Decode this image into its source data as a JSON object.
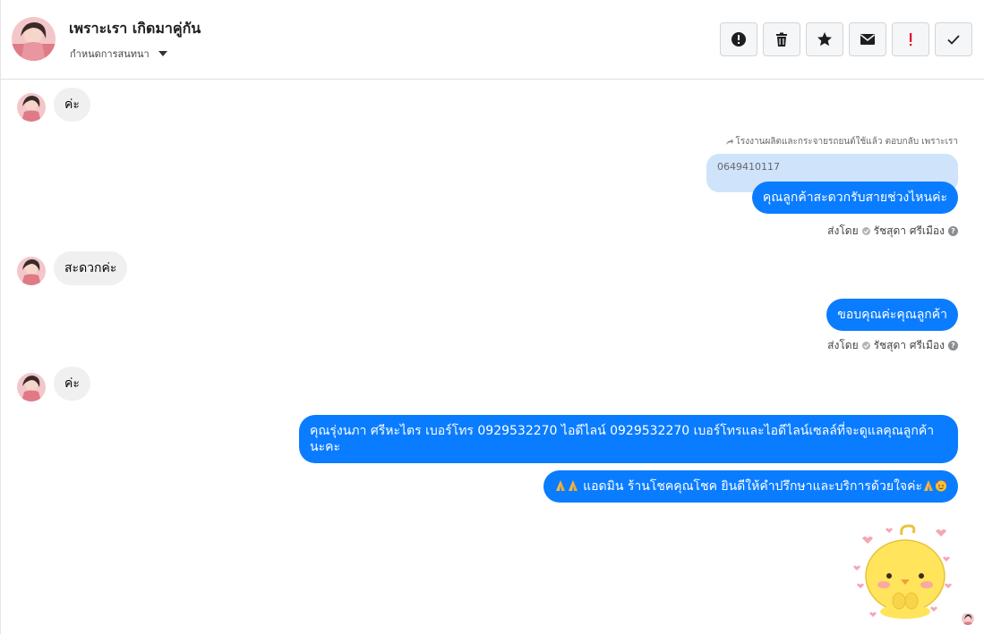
{
  "header": {
    "contact_name": "เพราะเรา เกิดมาคู่กัน",
    "conversation_menu_label": "กำหนดการสนทนา",
    "toolbar": {
      "buttons": [
        {
          "icon": "alert-circle-icon"
        },
        {
          "icon": "trash-icon"
        },
        {
          "icon": "star-icon"
        },
        {
          "icon": "mail-icon"
        },
        {
          "icon": "exclamation-icon"
        },
        {
          "icon": "checkmark-icon"
        }
      ]
    }
  },
  "colors": {
    "outgoing_bubble": "#0a7cff",
    "incoming_bubble": "#f0f0f0",
    "quote_bubble": "#cfe3fb",
    "exclamation_red": "#e4002b"
  },
  "messages": {
    "m1_incoming": "ค่ะ",
    "reply_note": "โรงงานผลิตและกระจายรถยนต์ใช้แล้ว ตอบกลับ เพราะเรา",
    "quoted_text": "0649410117",
    "m2_outgoing": "คุณลูกค้าสะดวกรับสายช่วงไหนค่ะ",
    "sent_by_1": {
      "prefix": "ส่งโดย",
      "agent": "รัชสุดา ศรีเมือง"
    },
    "m3_incoming": "สะดวกค่ะ",
    "m4_outgoing": "ขอบคุณค่ะคุณลูกค้า",
    "sent_by_2": {
      "prefix": "ส่งโดย",
      "agent": "รัชสุดา ศรีเมือง"
    },
    "m5_incoming": "ค่ะ",
    "m6_outgoing": "คุณรุ่งนภา ศรีหะไตร        เบอร์โทร 0929532270  ไอดีไลน์ 0929532270   เบอร์โทรและไอดีไลน์เซลล์ที่จะดูแลคุณลูกค้านะคะ",
    "m7_outgoing": "แอดมิน ร้านโชคคุณโชค ยินดีให้คำปรึกษาและบริการด้วยใจค่ะ",
    "m7_emoji": [
      "folded-hands-icon",
      "folded-hands-icon",
      "folded-hands-icon",
      "smiling-face-with-hearts-icon"
    ],
    "sticker": "yellow-chick-sticker"
  }
}
